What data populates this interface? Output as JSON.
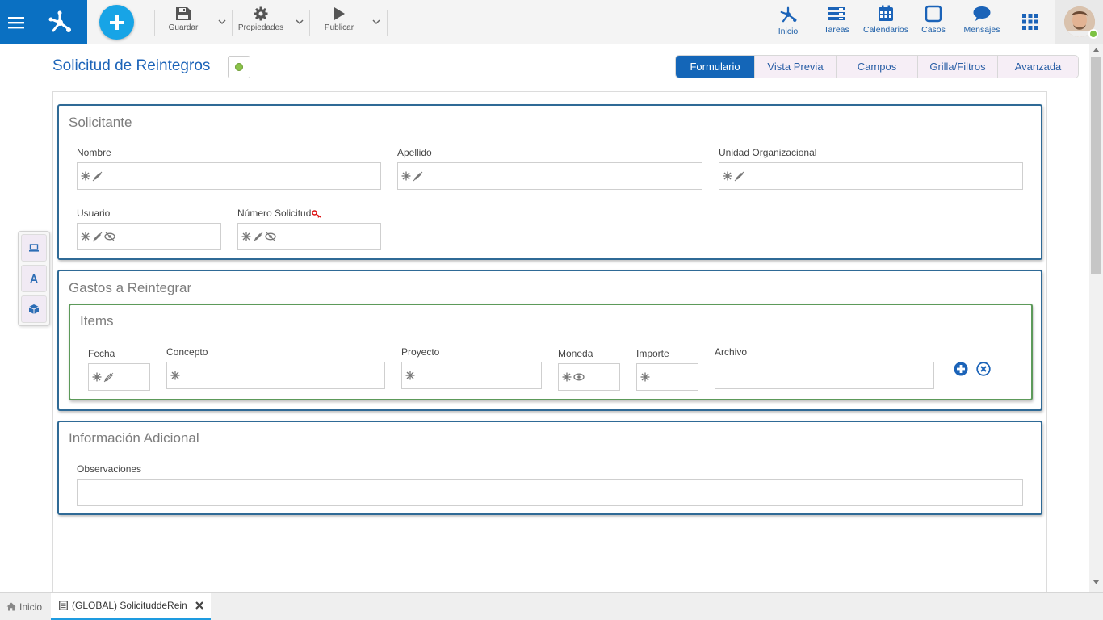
{
  "toolbar": {
    "save_label": "Guardar",
    "properties_label": "Propiedades",
    "publish_label": "Publicar"
  },
  "nav": {
    "home_label": "Inicio",
    "tasks_label": "Tareas",
    "calendars_label": "Calendarios",
    "cases_label": "Casos",
    "messages_label": "Mensajes"
  },
  "page": {
    "title": "Solicitud de Reintegros"
  },
  "tabs": [
    "Formulario",
    "Vista Previa",
    "Campos",
    "Grilla/Filtros",
    "Avanzada"
  ],
  "active_tab": "Formulario",
  "sections": {
    "applicant": {
      "title": "Solicitante",
      "fields": {
        "first_name": "Nombre",
        "last_name": "Apellido",
        "org_unit": "Unidad Organizacional",
        "user": "Usuario",
        "request_number": "Número Solicitud"
      }
    },
    "expenses": {
      "title": "Gastos a Reintegrar",
      "items": {
        "title": "Items",
        "columns": {
          "date": "Fecha",
          "concept": "Concepto",
          "project": "Proyecto",
          "currency": "Moneda",
          "amount": "Importe",
          "file": "Archivo"
        }
      }
    },
    "additional": {
      "title": "Información Adicional",
      "fields": {
        "notes": "Observaciones"
      }
    }
  },
  "bottom_tabs": {
    "home": "Inicio",
    "document": "(GLOBAL) SolicituddeRein"
  },
  "colors": {
    "brand_blue": "#0a70c2",
    "add_button": "#17a4e6",
    "section_border": "#2f6a96",
    "grid_border": "#5d9a5a",
    "active_tab": "#1466b8",
    "status_green": "#8bc34a"
  },
  "icons": {
    "menu": "hamburger-icon",
    "logo": "network-logo-icon",
    "add": "plus-icon",
    "save": "floppy-disk-icon",
    "properties": "gear-icon",
    "publish": "play-icon",
    "home": "network-icon",
    "tasks": "list-icon",
    "calendars": "calendar-icon",
    "cases": "square-icon",
    "messages": "speech-bubble-icon",
    "apps": "grid-icon",
    "required": "asterisk-icon",
    "editable": "pencil-icon",
    "hidden": "eye-icon",
    "key": "key-icon"
  }
}
